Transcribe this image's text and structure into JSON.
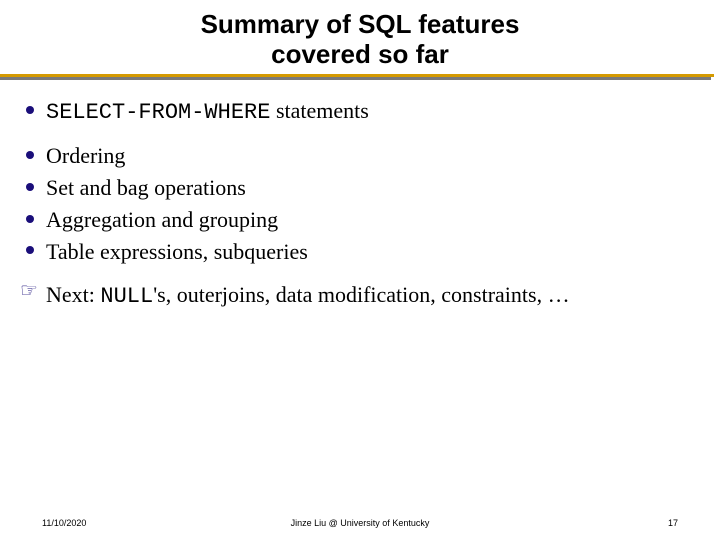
{
  "title_line1": "Summary of SQL features",
  "title_line2": "covered so far",
  "bullets_group1": {
    "item0_code": "SELECT-FROM-WHERE",
    "item0_rest": " statements"
  },
  "bullets_group2": {
    "item0": "Ordering",
    "item1": "Set and bag operations",
    "item2": "Aggregation and grouping",
    "item3": "Table expressions, subqueries"
  },
  "next": {
    "lead": "Next: ",
    "code": "NULL",
    "rest": "'s, outerjoins, data modification, constraints, …"
  },
  "footer": {
    "date": "11/10/2020",
    "center": "Jinze Liu @ University of Kentucky",
    "page": "17"
  }
}
